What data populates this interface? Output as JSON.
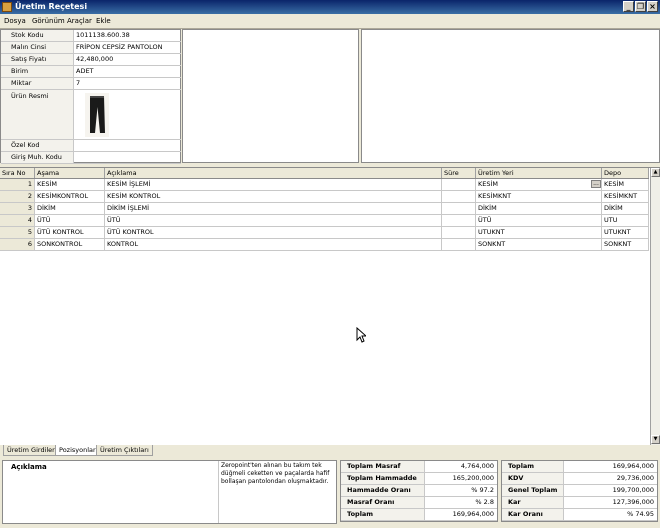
{
  "window": {
    "title": "Üretim Reçetesi"
  },
  "menu": [
    "Dosya",
    "Görünüm",
    "Araçlar",
    "Ekle"
  ],
  "product": {
    "fields": [
      {
        "label": "Stok Kodu",
        "value": "1011138.600.38"
      },
      {
        "label": "Malın Cinsi",
        "value": "FRİPON CEPSİZ PANTOLON"
      },
      {
        "label": "Satış Fiyatı",
        "value": "42,480,000"
      },
      {
        "label": "Birim",
        "value": "ADET"
      },
      {
        "label": "Miktar",
        "value": "7"
      }
    ],
    "image_label": "Ürün Resmi",
    "extra_fields": [
      {
        "label": "Özel Kod",
        "value": ""
      },
      {
        "label": "Giriş Muh. Kodu",
        "value": ""
      }
    ]
  },
  "grid": {
    "headers": [
      "Sıra No",
      "Aşama",
      "Açıklama",
      "Süre",
      "Üretim Yeri",
      "Depo"
    ],
    "rows": [
      [
        "1",
        "KESİM",
        "KESİM İŞLEMİ",
        "",
        "KESİM",
        "KESİM"
      ],
      [
        "2",
        "KESİMKONTROL",
        "KESİM KONTROL",
        "",
        "KESİMKNT",
        "KESİMKNT"
      ],
      [
        "3",
        "DİKİM",
        "DİKİM İŞLEMİ",
        "",
        "DİKİM",
        "DİKİM"
      ],
      [
        "4",
        "ÜTÜ",
        "ÜTÜ",
        "",
        "ÜTÜ",
        "UTU"
      ],
      [
        "5",
        "ÜTÜ KONTROL",
        "ÜTÜ KONTROL",
        "",
        "UTUKNT",
        "UTUKNT"
      ],
      [
        "6",
        "SONKONTROL",
        "KONTROL",
        "",
        "SONKNT",
        "SONKNT"
      ]
    ],
    "ellipsis": "..."
  },
  "tabs": [
    "Üretim Girdileri",
    "Pozisyonlar",
    "Üretim Çıktıları"
  ],
  "description": {
    "label": "Açıklama",
    "text": "Zeropoint'ten alınan bu takım tek düğmeli ceketten ve paçalarda hafif bollaşan pantolondan oluşmaktadır."
  },
  "summary_left": [
    {
      "label": "Toplam Masraf",
      "value": "4,764,000"
    },
    {
      "label": "Toplam Hammadde",
      "value": "165,200,000"
    },
    {
      "label": "Hammadde Oranı",
      "value": "% 97.2"
    },
    {
      "label": "Masraf Oranı",
      "value": "% 2.8"
    },
    {
      "label": "Toplam",
      "value": "169,964,000"
    }
  ],
  "summary_right": [
    {
      "label": "Toplam",
      "value": "169,964,000"
    },
    {
      "label": "KDV",
      "value": "29,736,000"
    },
    {
      "label": "Genel Toplam",
      "value": "199,700,000"
    },
    {
      "label": "Kar",
      "value": "127,396,000"
    },
    {
      "label": "Kar Oranı",
      "value": "% 74.95"
    }
  ]
}
